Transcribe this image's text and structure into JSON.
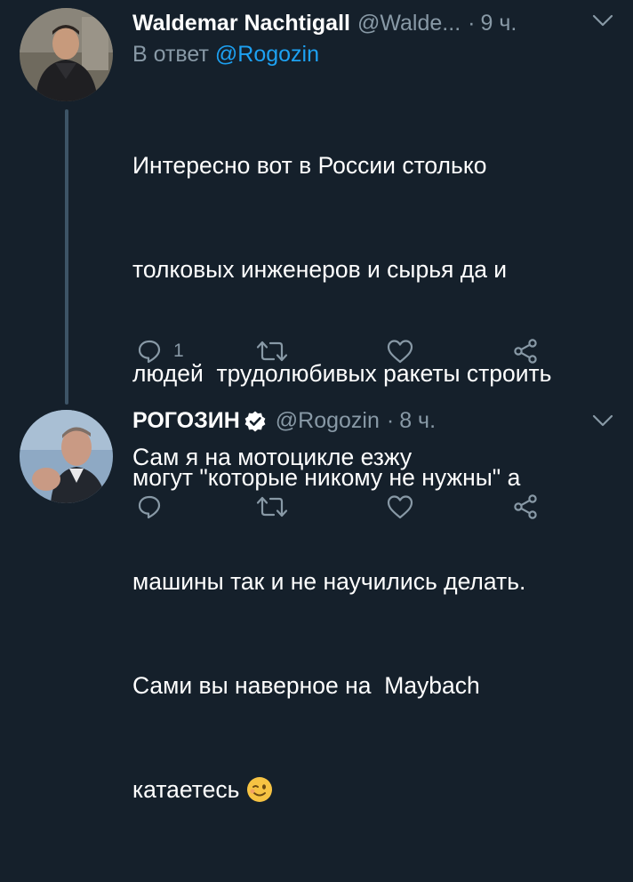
{
  "tweets": [
    {
      "author_name": "Waldemar Nachtigall",
      "handle": "@Walde...",
      "separator": "·",
      "time": "9 ч.",
      "reply_prefix": "В ответ",
      "reply_mention": "@Rogozin",
      "text_lines": [
        "Интересно вот в России столько",
        "толковых инженеров и сырья да и",
        "людей  трудолюбивых ракеты строить",
        "могут \"которые никому не нужны\" а",
        "машины так и не научились делать.",
        "Сами вы наверное на  Maybach",
        "катаетесь"
      ],
      "emoji": "winking-face",
      "reply_count": "1"
    },
    {
      "author_name": "РОГОЗИН",
      "verified": true,
      "handle": "@Rogozin",
      "separator": "·",
      "time": "8 ч.",
      "text": "Сам я на мотоцикле езжу"
    }
  ],
  "colors": {
    "background": "#15202b",
    "text": "#ffffff",
    "secondary": "#8899a6",
    "accent": "#1da1f2",
    "thread_line": "#3d5466"
  }
}
